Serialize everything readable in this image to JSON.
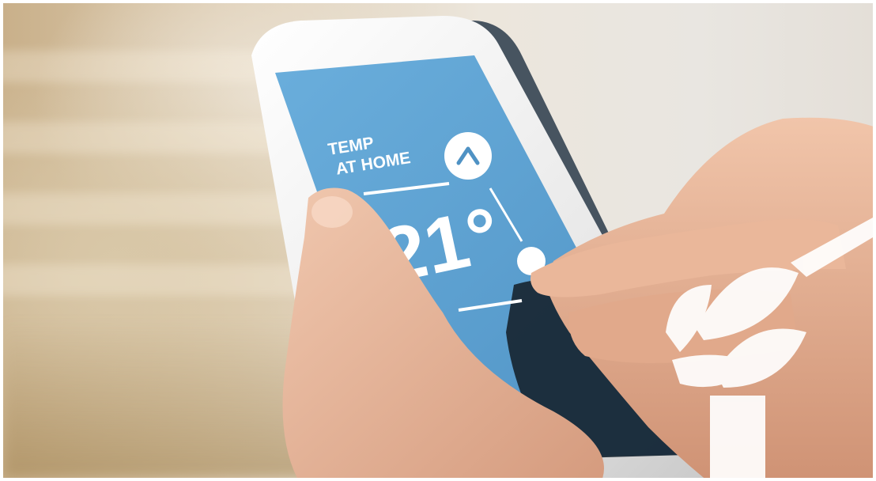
{
  "thermostat_app": {
    "heading_line1": "TEMP",
    "heading_line2": "AT HOME",
    "temperature": "21°",
    "up_control_icon": "chevron-up-icon",
    "slider_knob_icon": "circle-knob-icon"
  },
  "colors": {
    "screen_blue": "#5fa3d3",
    "screen_text": "#ffffff",
    "phone_body": "#f3f3f3",
    "skin": "#e7b79c",
    "watermark_white": "#ffffff"
  }
}
